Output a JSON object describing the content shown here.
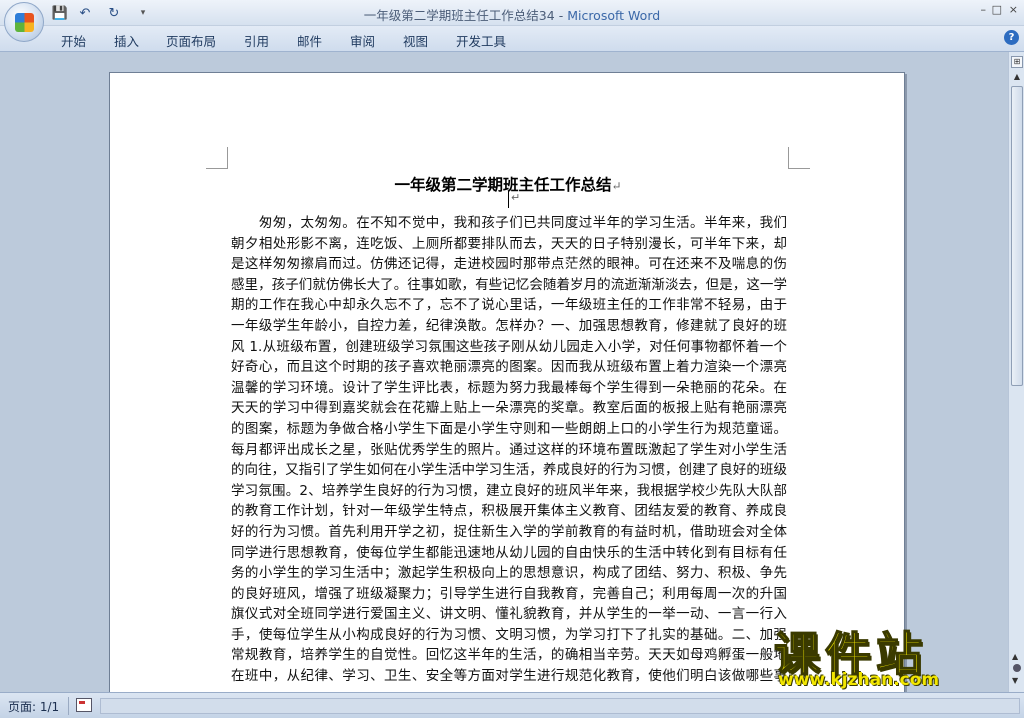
{
  "window": {
    "title_doc": "一年级第二学期班主任工作总结34",
    "title_sep": " - ",
    "title_app": "Microsoft Word",
    "controls": {
      "min": "–",
      "max": "□",
      "close": "×"
    }
  },
  "quick_access": {
    "save_icon": "💾",
    "undo_icon": "↶",
    "redo_icon": "↻",
    "more_icon": "▾"
  },
  "ribbon": {
    "tabs": [
      "开始",
      "插入",
      "页面布局",
      "引用",
      "邮件",
      "审阅",
      "视图",
      "开发工具"
    ],
    "help": "?"
  },
  "document": {
    "title": "一年级第二学期班主任工作总结",
    "para_mark": "↵",
    "lines": [
      "　　匆匆，太匆匆。在不知不觉中，我和孩子们已共同度过半年的学习生活。半年来，我们",
      "朝夕相处形影不离，连吃饭、上厕所都要排队而去，天天的日子特别漫长，可半年下来，却",
      "是这样匆匆擦肩而过。仿佛还记得，走进校园时那带点茫然的眼神。可在还来不及喘息的伤",
      "感里，孩子们就仿佛长大了。往事如歌，有些记忆会随着岁月的流逝渐渐淡去，但是，这一学",
      "期的工作在我心中却永久忘不了，忘不了说心里话，一年级班主任的工作非常不轻易，由于",
      "一年级学生年龄小，自控力差，纪律涣散。怎样办？一、加强思想教育，修建就了良好的班",
      "风 1.从班级布置，创建班级学习氛围这些孩子刚从幼儿园走入小学，对任何事物都怀着一个",
      "好奇心，而且这个时期的孩子喜欢艳丽漂亮的图案。因而我从班级布置上着力渲染一个漂亮",
      "温馨的学习环境。设计了学生评比表，标题为努力我最棒每个学生得到一朵艳丽的花朵。在",
      "天天的学习中得到嘉奖就会在花瓣上贴上一朵漂亮的奖章。教室后面的板报上贴有艳丽漂亮",
      "的图案，标题为争做合格小学生下面是小学生守则和一些朗朗上口的小学生行为规范童谣。",
      "每月都评出成长之星，张贴优秀学生的照片。通过这样的环境布置既激起了学生对小学生活",
      "的向往，又指引了学生如何在小学生活中学习生活，养成良好的行为习惯，创建了良好的班级",
      "学习氛围。2、培养学生良好的行为习惯，建立良好的班风半年来，我根据学校少先队大队部",
      "的教育工作计划，针对一年级学生特点，积极展开集体主义教育、团结友爱的教育、养成良",
      "好的行为习惯。首先利用开学之初，捉住新生入学的学前教育的有益时机，借助班会对全体",
      "同学进行思想教育，使每位学生都能迅速地从幼儿园的自由快乐的生活中转化到有目标有任",
      "务的小学生的学习生活中；激起学生积极向上的思想意识，构成了团结、努力、积极、争先",
      "的良好班风，增强了班级凝聚力；引导学生进行自我教育，完善自己；利用每周一次的升国",
      "旗仪式对全班同学进行爱国主义、讲文明、懂礼貌教育，并从学生的一举一动、一言一行入",
      "手，使每位学生从小构成良好的行为习惯、文明习惯，为学习打下了扎实的基础。二、加强",
      "常规教育，培养学生的自觉性。回忆这半年的生活，的确相当辛劳。天天如母鸡孵蛋一般地",
      "在班中，从纪律、学习、卫生、安全等方面对学生进行规范化教育，使他们明白该做哪些事"
    ]
  },
  "scrollbar": {
    "ruler_icon": "⊞",
    "up": "▲",
    "prev": "▲",
    "next": "▼"
  },
  "statusbar": {
    "page": "页面: 1/1"
  },
  "watermark": {
    "main": "课件站",
    "url": "www.kjzhan.com"
  }
}
